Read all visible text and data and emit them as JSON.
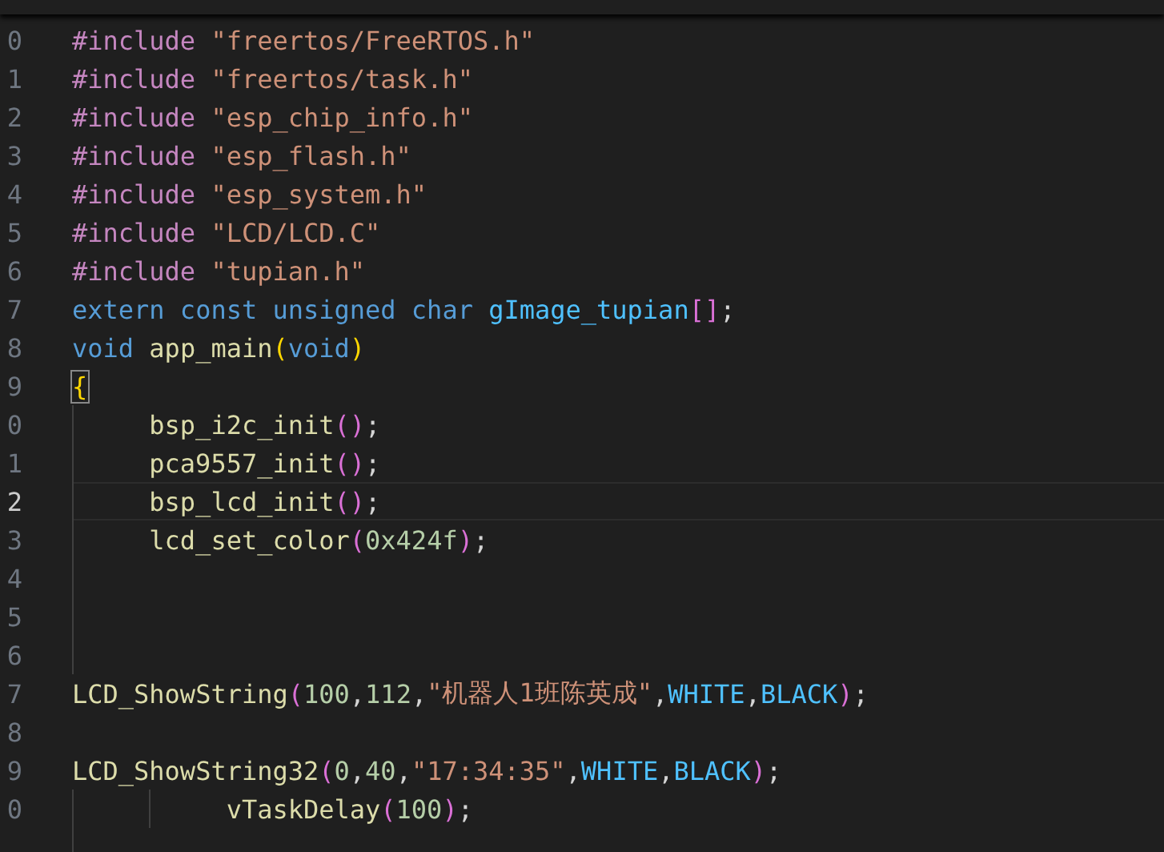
{
  "editor": {
    "lines": [
      {
        "number": "0",
        "current": false,
        "tokens": [
          {
            "kind": "preproc",
            "text": "#include "
          },
          {
            "kind": "string",
            "text": "\"freertos/FreeRTOS.h\""
          }
        ]
      },
      {
        "number": "1",
        "current": false,
        "tokens": [
          {
            "kind": "preproc",
            "text": "#include "
          },
          {
            "kind": "string",
            "text": "\"freertos/task.h\""
          }
        ]
      },
      {
        "number": "2",
        "current": false,
        "tokens": [
          {
            "kind": "preproc",
            "text": "#include "
          },
          {
            "kind": "string",
            "text": "\"esp_chip_info.h\""
          }
        ]
      },
      {
        "number": "3",
        "current": false,
        "tokens": [
          {
            "kind": "preproc",
            "text": "#include "
          },
          {
            "kind": "string",
            "text": "\"esp_flash.h\""
          }
        ]
      },
      {
        "number": "4",
        "current": false,
        "tokens": [
          {
            "kind": "preproc",
            "text": "#include "
          },
          {
            "kind": "string",
            "text": "\"esp_system.h\""
          }
        ]
      },
      {
        "number": "5",
        "current": false,
        "tokens": [
          {
            "kind": "preproc",
            "text": "#include "
          },
          {
            "kind": "string",
            "text": "\"LCD/LCD.C\""
          }
        ]
      },
      {
        "number": "6",
        "current": false,
        "tokens": [
          {
            "kind": "preproc",
            "text": "#include "
          },
          {
            "kind": "string",
            "text": "\"tupian.h\""
          }
        ]
      },
      {
        "number": "7",
        "current": false,
        "tokens": [
          {
            "kind": "keyword",
            "text": "extern const unsigned char "
          },
          {
            "kind": "global",
            "text": "gImage_tupian"
          },
          {
            "kind": "paren2",
            "text": "[]"
          },
          {
            "kind": "plain",
            "text": ";"
          }
        ]
      },
      {
        "number": "8",
        "current": false,
        "tokens": [
          {
            "kind": "keyword",
            "text": "void "
          },
          {
            "kind": "function",
            "text": "app_main"
          },
          {
            "kind": "paren1",
            "text": "("
          },
          {
            "kind": "keyword",
            "text": "void"
          },
          {
            "kind": "paren1",
            "text": ")"
          }
        ]
      },
      {
        "number": "9",
        "current": false,
        "tokens": [
          {
            "kind": "paren1",
            "text": "{",
            "matched": true
          }
        ]
      },
      {
        "number": "0",
        "current": false,
        "guides": [
          {
            "kind": "tab"
          }
        ],
        "tokens": [
          {
            "kind": "function",
            "text": "bsp_i2c_init"
          },
          {
            "kind": "paren2",
            "text": "()"
          },
          {
            "kind": "plain",
            "text": ";"
          }
        ]
      },
      {
        "number": "1",
        "current": false,
        "guides": [
          {
            "kind": "tab"
          }
        ],
        "tokens": [
          {
            "kind": "function",
            "text": "pca9557_init"
          },
          {
            "kind": "paren2",
            "text": "()"
          },
          {
            "kind": "plain",
            "text": ";"
          }
        ]
      },
      {
        "number": "2",
        "current": true,
        "guides": [
          {
            "kind": "tab"
          }
        ],
        "tokens": [
          {
            "kind": "function",
            "text": "bsp_lcd_init"
          },
          {
            "kind": "paren2",
            "text": "()"
          },
          {
            "kind": "plain",
            "text": ";"
          }
        ]
      },
      {
        "number": "3",
        "current": false,
        "guides": [
          {
            "kind": "tab"
          }
        ],
        "tokens": [
          {
            "kind": "function",
            "text": "lcd_set_color"
          },
          {
            "kind": "paren2",
            "text": "("
          },
          {
            "kind": "number",
            "text": "0x424f"
          },
          {
            "kind": "paren2",
            "text": ")"
          },
          {
            "kind": "plain",
            "text": ";"
          }
        ]
      },
      {
        "number": "4",
        "current": false,
        "guides": [
          {
            "kind": "tab"
          }
        ]
      },
      {
        "number": "5",
        "current": false,
        "guides": [
          {
            "kind": "tab"
          }
        ]
      },
      {
        "number": "6",
        "current": false,
        "guides": [
          {
            "kind": "tab"
          }
        ]
      },
      {
        "number": "7",
        "current": false,
        "tokens": [
          {
            "kind": "function",
            "text": "LCD_ShowString"
          },
          {
            "kind": "paren2",
            "text": "("
          },
          {
            "kind": "number",
            "text": "100"
          },
          {
            "kind": "plain",
            "text": ","
          },
          {
            "kind": "number",
            "text": "112"
          },
          {
            "kind": "plain",
            "text": ","
          },
          {
            "kind": "string",
            "text": "\"机器人1班陈英成\""
          },
          {
            "kind": "plain",
            "text": ","
          },
          {
            "kind": "macro",
            "text": "WHITE"
          },
          {
            "kind": "plain",
            "text": ","
          },
          {
            "kind": "macro",
            "text": "BLACK"
          },
          {
            "kind": "paren2",
            "text": ")"
          },
          {
            "kind": "plain",
            "text": ";"
          }
        ]
      },
      {
        "number": "8",
        "current": false
      },
      {
        "number": "9",
        "current": false,
        "tokens": [
          {
            "kind": "function",
            "text": "LCD_ShowString32"
          },
          {
            "kind": "paren2",
            "text": "("
          },
          {
            "kind": "number",
            "text": "0"
          },
          {
            "kind": "plain",
            "text": ","
          },
          {
            "kind": "number",
            "text": "40"
          },
          {
            "kind": "plain",
            "text": ","
          },
          {
            "kind": "string",
            "text": "\"17:34:35\""
          },
          {
            "kind": "plain",
            "text": ","
          },
          {
            "kind": "macro",
            "text": "WHITE"
          },
          {
            "kind": "plain",
            "text": ","
          },
          {
            "kind": "macro",
            "text": "BLACK"
          },
          {
            "kind": "paren2",
            "text": ")"
          },
          {
            "kind": "plain",
            "text": ";"
          }
        ]
      },
      {
        "number": "0",
        "current": false,
        "guides": [
          {
            "kind": "tab"
          },
          {
            "kind": "tab"
          }
        ],
        "tokens": [
          {
            "kind": "function",
            "text": "vTaskDelay"
          },
          {
            "kind": "paren2",
            "text": "("
          },
          {
            "kind": "number",
            "text": "100"
          },
          {
            "kind": "paren2",
            "text": ")"
          },
          {
            "kind": "plain",
            "text": ";"
          }
        ]
      },
      {
        "current": false,
        "guides": [
          {
            "kind": "tab"
          }
        ]
      }
    ]
  }
}
